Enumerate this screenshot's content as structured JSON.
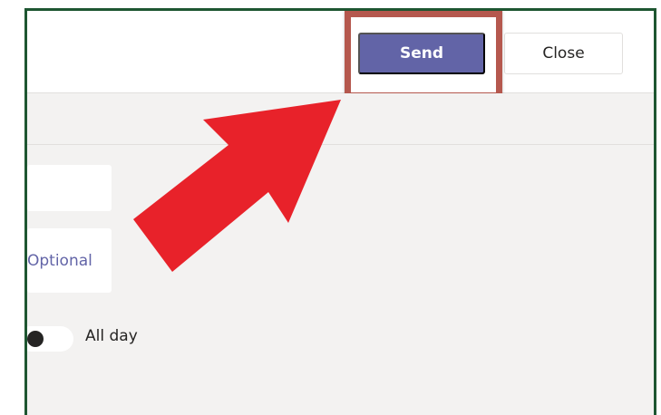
{
  "dialog": {
    "send_label": "Send",
    "close_label": "Close"
  },
  "form": {
    "optional_placeholder": "Optional",
    "all_day_label": "All day",
    "all_day_toggle": "off"
  },
  "annotation": {
    "highlight_color": "#b5584e",
    "arrow_color": "#e8222a"
  },
  "colors": {
    "accent": "#6264a7",
    "frame_border": "#1e5631",
    "background": "#f3f2f1"
  }
}
